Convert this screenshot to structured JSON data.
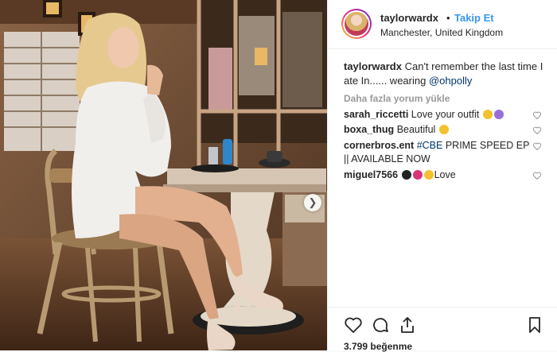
{
  "post": {
    "username": "taylorwardx",
    "separator": "•",
    "follow_label": "Takip Et",
    "location": "Manchester, United Kingdom",
    "caption": {
      "username": "taylorwardx",
      "text": "Can't remember the last time I ate In...... wearing",
      "mention": "@ohpolly"
    },
    "load_more": "Daha fazla yorum yükle",
    "comments": [
      {
        "username": "sarah_riccetti",
        "text": "Love your outfit"
      },
      {
        "username": "boxa_thug",
        "text": "Beautiful"
      },
      {
        "username": "cornerbros.ent",
        "tag": "#CBE",
        "text": "PRIME SPEED EP || AVAILABLE NOW"
      },
      {
        "username": "miguel7566",
        "text": "Love"
      }
    ],
    "likes": "3.799 beğenme"
  },
  "colors": {
    "link": "#3897f0",
    "mention": "#003569",
    "muted": "#999999",
    "text": "#262626"
  },
  "icons": [
    "chevron-right-icon",
    "heart-icon",
    "comment-icon",
    "share-icon",
    "bookmark-icon"
  ]
}
